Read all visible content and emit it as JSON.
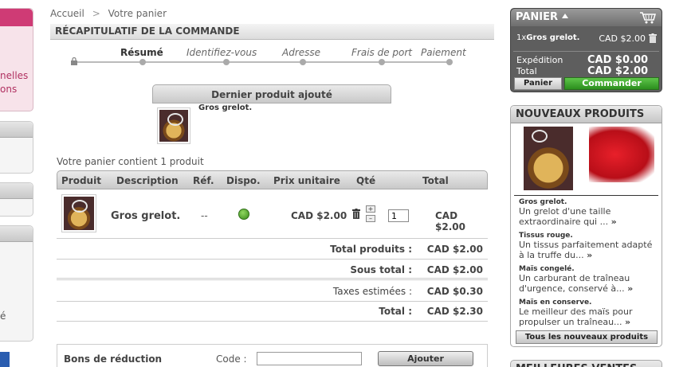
{
  "left": {
    "pink_text": [
      "nelles",
      "ons"
    ],
    "e_text": "é"
  },
  "breadcrumb": {
    "home": "Accueil",
    "sep": ">",
    "current": "Votre panier"
  },
  "page_title": "RÉCAPITULATIF DE LA COMMANDE",
  "steps": [
    "Résumé",
    "Identifiez-vous",
    "Adresse",
    "Frais de port",
    "Paiement"
  ],
  "last_added": {
    "title": "Dernier produit ajouté",
    "product_name": "Gros grelot."
  },
  "cart_count_text": "Votre panier contient 1 produit",
  "table": {
    "headers": [
      "Produit",
      "Description",
      "Réf.",
      "Dispo.",
      "Prix unitaire",
      "Qté",
      "Total"
    ],
    "rows": [
      {
        "name": "Gros grelot.",
        "ref": "--",
        "stock": "in-stock",
        "unit_price": "CAD $2.00",
        "qty": "1",
        "total": "CAD $2.00"
      }
    ],
    "plus": "+",
    "minus": "–"
  },
  "summary": {
    "total_products_label": "Total produits :",
    "total_products": "CAD $2.00",
    "subtotal_label": "Sous total :",
    "subtotal": "CAD $2.00",
    "taxes_label": "Taxes estimées :",
    "taxes": "CAD $0.30",
    "total_label": "Total :",
    "total": "CAD $2.30"
  },
  "voucher": {
    "title": "Bons de réduction",
    "code_label": "Code :",
    "code_value": "",
    "button": "Ajouter"
  },
  "cart_block": {
    "title": "PANIER",
    "item_qty": "1x",
    "item_name": "Gros grelot.",
    "item_price": "CAD $2.00",
    "shipping_label": "Expédition",
    "shipping": "CAD $0.00",
    "total_label": "Total",
    "total": "CAD $2.00",
    "btn_cart": "Panier",
    "btn_order": "Commander"
  },
  "new_products": {
    "title": "NOUVEAUX PRODUITS",
    "items": [
      {
        "title": "Gros grelot.",
        "desc": "Un grelot d'une taille extraordinaire qui ...",
        "more": "»"
      },
      {
        "title": "Tissus rouge.",
        "desc": "Un tissus parfaitement adapté à la truffe du...",
        "more": "»"
      },
      {
        "title": "Maïs congelé.",
        "desc": "Un carburant de traîneau d'urgence, conservé à...",
        "more": "»"
      },
      {
        "title": "Maïs en conserve.",
        "desc": "Le meilleur des maïs pour propulser un traîneau...",
        "more": "»"
      }
    ],
    "all_button": "Tous les nouveaux produits"
  },
  "best_sales": {
    "title": "MEILLEURES VENTES"
  },
  "colors": {
    "accent_green": "#2b8f1d",
    "cart_bg": "#5e5e5e",
    "pink": "#cf3b75"
  }
}
